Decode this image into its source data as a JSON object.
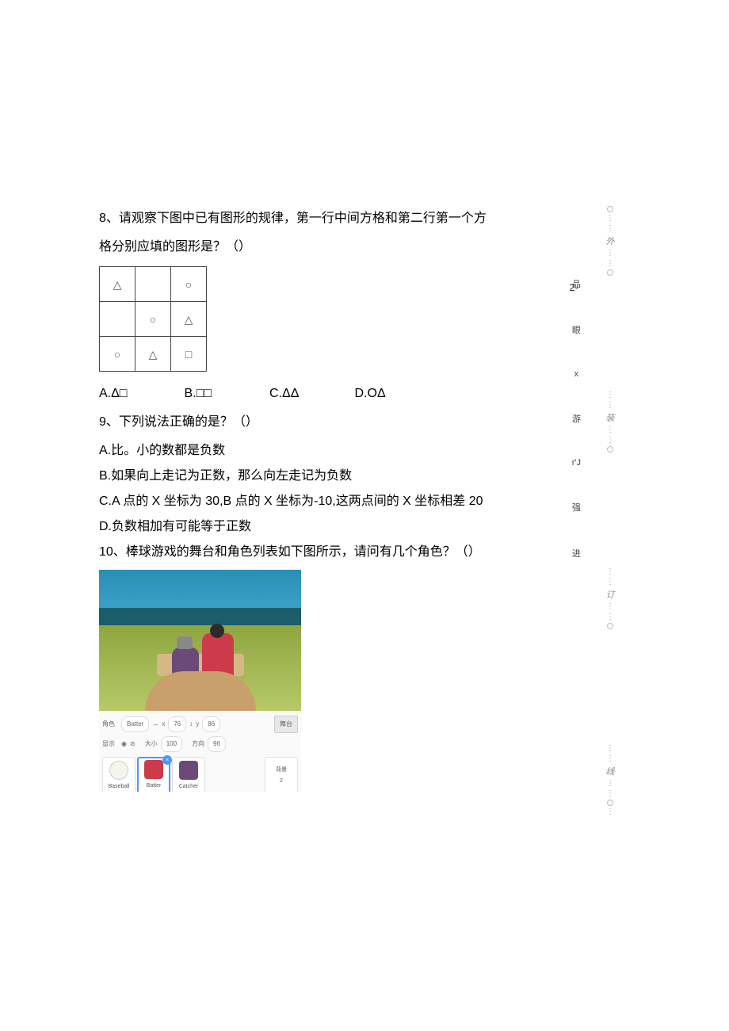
{
  "q8": {
    "text": "8、请观察下图中已有图形的规律，第一行中间方格和第二行第一个方",
    "text2": "格分别应填的图形是？（）",
    "grid": [
      [
        "△",
        "",
        "○"
      ],
      [
        "",
        "○",
        "△"
      ],
      [
        "○",
        "△",
        "□"
      ]
    ],
    "options": {
      "a": "A.Δ□",
      "b": "B.□□",
      "c": "C.ΔΔ",
      "d": "D.OΔ"
    }
  },
  "q9": {
    "text": "9、下列说法正确的是？（）",
    "a": "A.比。小的数都是负数",
    "b": "B.如果向上走记为正数，那么向左走记为负数",
    "c": "C.A 点的 X 坐标为 30,B 点的 X 坐标为-10,这两点间的 X 坐标相差 20",
    "d": "D.负数相加有可能等于正数"
  },
  "q10": {
    "text": "10、棒球游戏的舞台和角色列表如下图所示，请问有几个角色？（）"
  },
  "scratch": {
    "role_label": "角色",
    "role_name": "Batter",
    "x_label": "x",
    "x_val": "76",
    "y_label": "y",
    "y_val": "86",
    "show_label": "显示",
    "size_label": "大小",
    "size_val": "100",
    "dir_label": "方向",
    "dir_val": "96",
    "stage_label": "舞台",
    "backdrop_label": "背景",
    "backdrop_count": "2",
    "sprites": [
      {
        "name": "Baseball"
      },
      {
        "name": "Batter"
      },
      {
        "name": "Catcher"
      }
    ]
  },
  "margin": {
    "page": "2-",
    "chars": [
      "品",
      "眼",
      "x",
      "游",
      "r'J",
      "强",
      "进"
    ],
    "binding_chars": [
      "外",
      "装",
      "订",
      "线"
    ]
  }
}
